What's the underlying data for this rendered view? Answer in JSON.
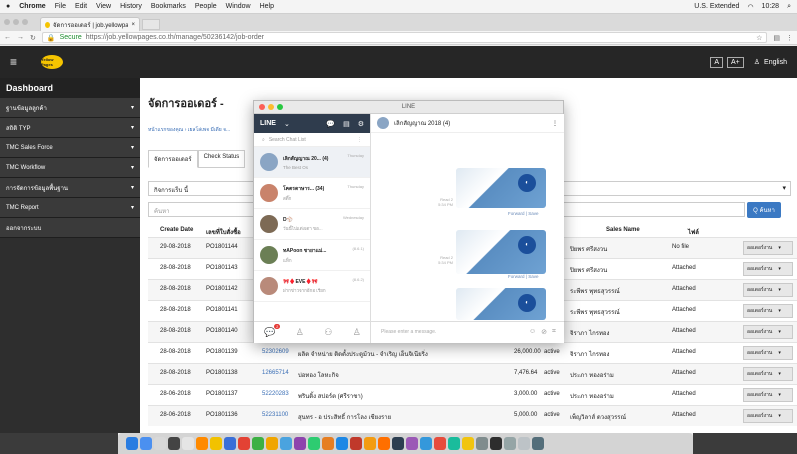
{
  "menubar": {
    "apple": "",
    "items": [
      "Chrome",
      "File",
      "Edit",
      "View",
      "History",
      "Bookmarks",
      "People",
      "Window",
      "Help"
    ],
    "right": [
      "U.S. Extended",
      "10:28"
    ]
  },
  "browser": {
    "tab_title": "จัดการออเดอร์ | job.yellowpages.c",
    "secure": "Secure",
    "url": "https://job.yellowpages.co.th/manage/50236142/job-order"
  },
  "site": {
    "logo": "Yellow Pages",
    "font_small": "A",
    "font_big": "A+",
    "lang": "English"
  },
  "sidebar": {
    "title": "Dashboard",
    "items": [
      "ฐานข้อมูลลูกค้า",
      "สถิติ TYP",
      "TMC Sales Force",
      "TMC Workflow",
      "การจัดการข้อมูลพื้นฐาน",
      "TMC Report",
      "ออกจากระบบ"
    ]
  },
  "main": {
    "title": "จัดการออเดอร์ -",
    "crumb": "หน้าแรกของคุณ › เยลโล่เพจ มีเดีย จ...",
    "tabs": [
      "จัดการออเดอร์",
      "Check Status"
    ],
    "status_label": "กิจการแร็บ นี้",
    "search_placeholder": "ค้นหา",
    "search_btn": "Q ค้นหา",
    "headers": [
      "Create Date",
      "เลขที่ใบสั่งซื้อ",
      "Sales Name",
      "ไฟล์"
    ],
    "rows": [
      {
        "date": "29-08-2018",
        "po": "PO1801144",
        "cust": "",
        "name": "",
        "amount": "",
        "status": "",
        "sales": "ปิยพร ศรีสงวน",
        "file": "No file"
      },
      {
        "date": "28-08-2018",
        "po": "PO1801143",
        "cust": "",
        "name": "",
        "amount": "",
        "status": "",
        "sales": "ปิยพร ศรีสงวน",
        "file": "Attached"
      },
      {
        "date": "28-08-2018",
        "po": "PO1801142",
        "cust": "",
        "name": "",
        "amount": "",
        "status": "",
        "sales": "ระพีพร พุทธสุวรรณ์",
        "file": "Attached"
      },
      {
        "date": "28-08-2018",
        "po": "PO1801141",
        "cust": "",
        "name": "",
        "amount": "",
        "status": "",
        "sales": "ระพีพร พุทธสุวรรณ์",
        "file": "Attached"
      },
      {
        "date": "28-08-2018",
        "po": "PO1801140",
        "cust": "",
        "name": "",
        "amount": "",
        "status": "",
        "sales": "จิราภา ไกรทอง",
        "file": "Attached"
      },
      {
        "date": "28-08-2018",
        "po": "PO1801139",
        "cust": "52302609",
        "name": "ผลิต จำหน่าย ติดตั้งประตูม้วน - จำเริญ เอ็นจิเนียริ่ง",
        "amount": "26,000.00",
        "status": "active",
        "sales": "จิราภา ไกรทอง",
        "file": "Attached"
      },
      {
        "date": "28-08-2018",
        "po": "PO1801138",
        "cust": "12665714",
        "name": "บ่อทอง โลหะกิจ",
        "amount": "7,476.64",
        "status": "active",
        "sales": "ประภา ทองอร่าม",
        "file": "Attached"
      },
      {
        "date": "28-06-2018",
        "po": "PO1801137",
        "cust": "52220283",
        "name": "พรินติ้ง สปอร์ต (ศรีราชา)",
        "amount": "3,000.00",
        "status": "active",
        "sales": "ประภา ทองอร่าม",
        "file": "Attached"
      },
      {
        "date": "28-06-2018",
        "po": "PO1801136",
        "cust": "52231100",
        "name": "สุนทร - อ ประสิทธิ์ การโลง เชียงราย",
        "amount": "5,000.00",
        "status": "active",
        "sales": "เพ็ญวิลาส์ ดวงสุวรรณ์",
        "file": "Attached"
      }
    ],
    "action_label": "ออเดอร์งาน"
  },
  "line": {
    "window_title": "LINE",
    "brand": "LINE",
    "search_placeholder": "Search Chat List",
    "chats": [
      {
        "name": "เลิกสัญญาณ 20... (4)",
        "preview": "The Best Os",
        "date": "Thursday",
        "color": "#8aa5c4"
      },
      {
        "name": "โคตรดาษาร... (34)",
        "preview": "สติ๊ก",
        "date": "Thursday",
        "color": "#c9836b"
      },
      {
        "name": "D⚾",
        "preview": "วันนี้ไปแต่งเดา ขอ...",
        "date": "Wednesday",
        "color": "#7d6a55"
      },
      {
        "name": "ทAPoon ชายาแม่...",
        "preview": "แท็ก",
        "date": "(8.6.1)",
        "color": "#6b7f55"
      },
      {
        "name": "🎀♦️EVE♦️🎀",
        "preview": "ฝากข่าวจากอีกอ เรียก",
        "date": "(8.6.2)",
        "color": "#b98a7a"
      }
    ],
    "chat_title": "เลิกสัญญาณ 2018 (4)",
    "read_label": "Read 2",
    "time1": "5:34 PM",
    "time2": "5:34 PM",
    "forward": "Forward",
    "save": "Save",
    "clinic": "CLINIC",
    "input_placeholder": "Please enter a message.",
    "badge": "2"
  }
}
